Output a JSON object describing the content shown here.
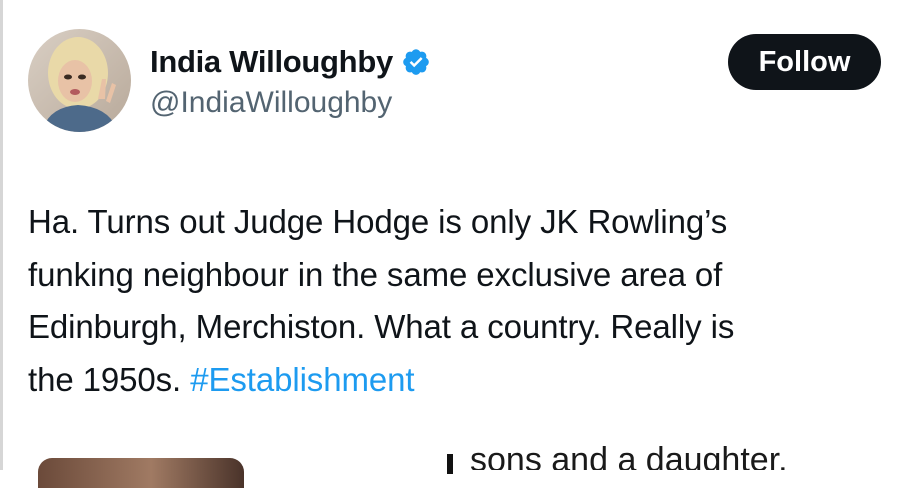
{
  "tweet": {
    "author": {
      "display_name": "India Willoughby",
      "handle": "@IndiaWilloughby",
      "verified": true,
      "verified_icon": "verified-badge-icon",
      "avatar_icon": "avatar-photo"
    },
    "follow_label": "Follow",
    "text_lines": [
      "Ha. Turns out Judge Hodge is only JK Rowling’s",
      "funking neighbour in the same exclusive area of",
      "Edinburgh, Merchiston. What a country. Really is",
      "the 1950s. "
    ],
    "hashtag": "#Establishment",
    "quoted_snippet": "sons and a daughter."
  },
  "colors": {
    "text": "#0f1419",
    "secondary_text": "#536471",
    "link": "#1d9bf0",
    "button_bg": "#0f1419",
    "button_text": "#ffffff",
    "verified": "#1d9bf0"
  }
}
